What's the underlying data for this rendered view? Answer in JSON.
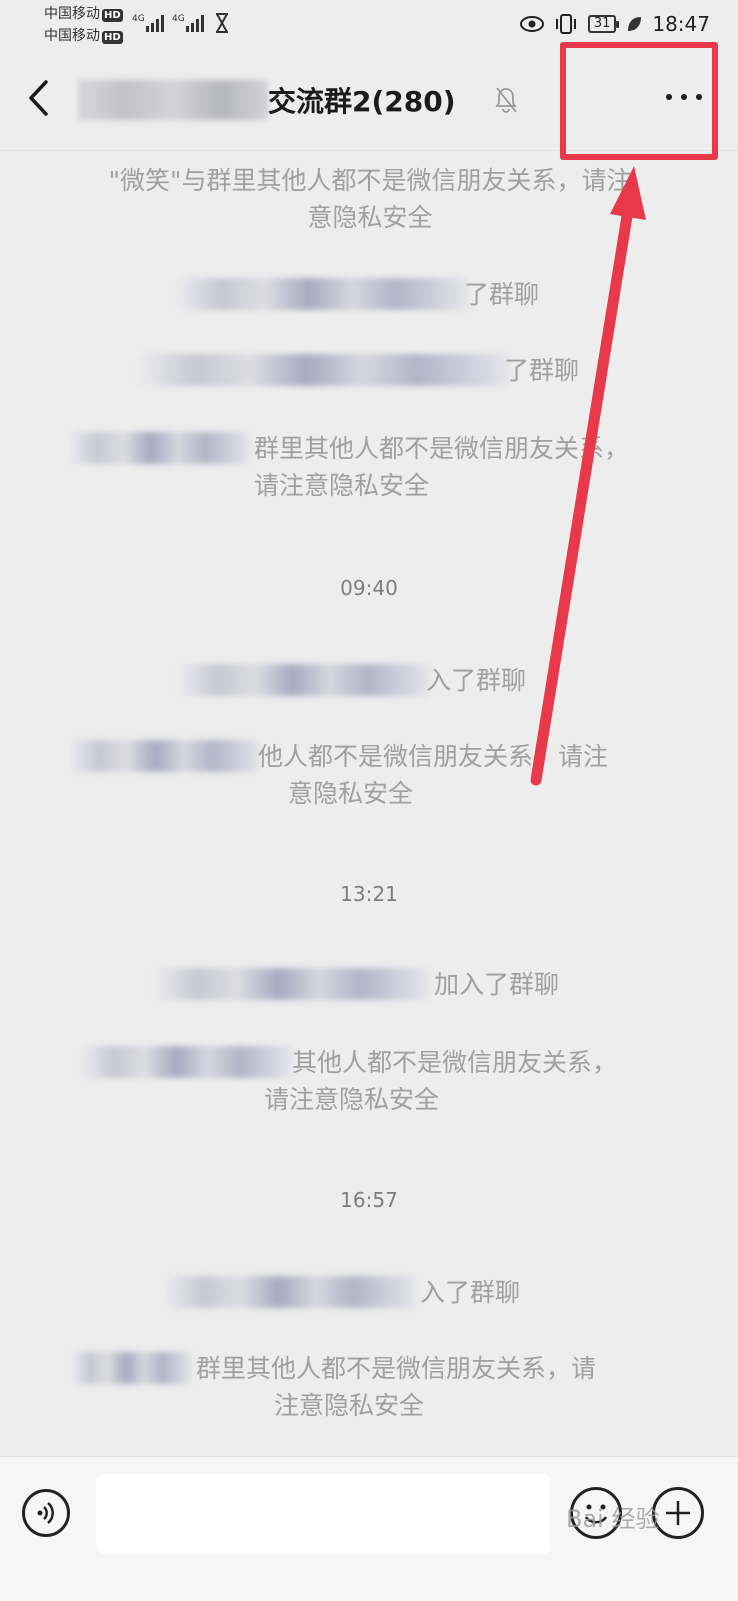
{
  "status_bar": {
    "carrier_1": "中国移动",
    "carrier_2": "中国移动",
    "hd": "HD",
    "network_1": "4G",
    "network_2": "4G",
    "battery": "31",
    "time": "18:47"
  },
  "header": {
    "title_visible": "交流群2(280)",
    "back_icon": "chevron-left-icon",
    "mute_icon": "bell-off-icon",
    "more_icon": "more-dots-icon"
  },
  "messages": [
    {
      "line1": "\"微笑\"与群里其他人都不是微信朋友关系，请注",
      "line2": "意隐私安全"
    },
    {
      "line1": "了群聊"
    },
    {
      "line1": "了群聊"
    },
    {
      "line1": "群里其他人都不是微信朋友关系，",
      "line2": "请注意隐私安全"
    },
    {
      "time": "09:40"
    },
    {
      "line1": "入了群聊"
    },
    {
      "line1": "他人都不是微信朋友关系，请注",
      "line2": "意隐私安全"
    },
    {
      "time": "13:21"
    },
    {
      "line1": "加入了群聊"
    },
    {
      "line1": "其他人都不是微信朋友关系，",
      "line2": "请注意隐私安全"
    },
    {
      "time": "16:57"
    },
    {
      "line1": "入了群聊"
    },
    {
      "line1": "群里其他人都不是微信朋友关系，请",
      "line2": "注意隐私安全"
    }
  ],
  "bottom_bar": {
    "voice_icon": "voice-icon",
    "input_placeholder": "",
    "emoji_icon": "emoji-icon",
    "plus_icon": "plus-icon",
    "watermark": "Bai 经验"
  },
  "colors": {
    "annotation": "#e8394a",
    "background": "#ededed",
    "system_text": "#a0a0a0"
  }
}
